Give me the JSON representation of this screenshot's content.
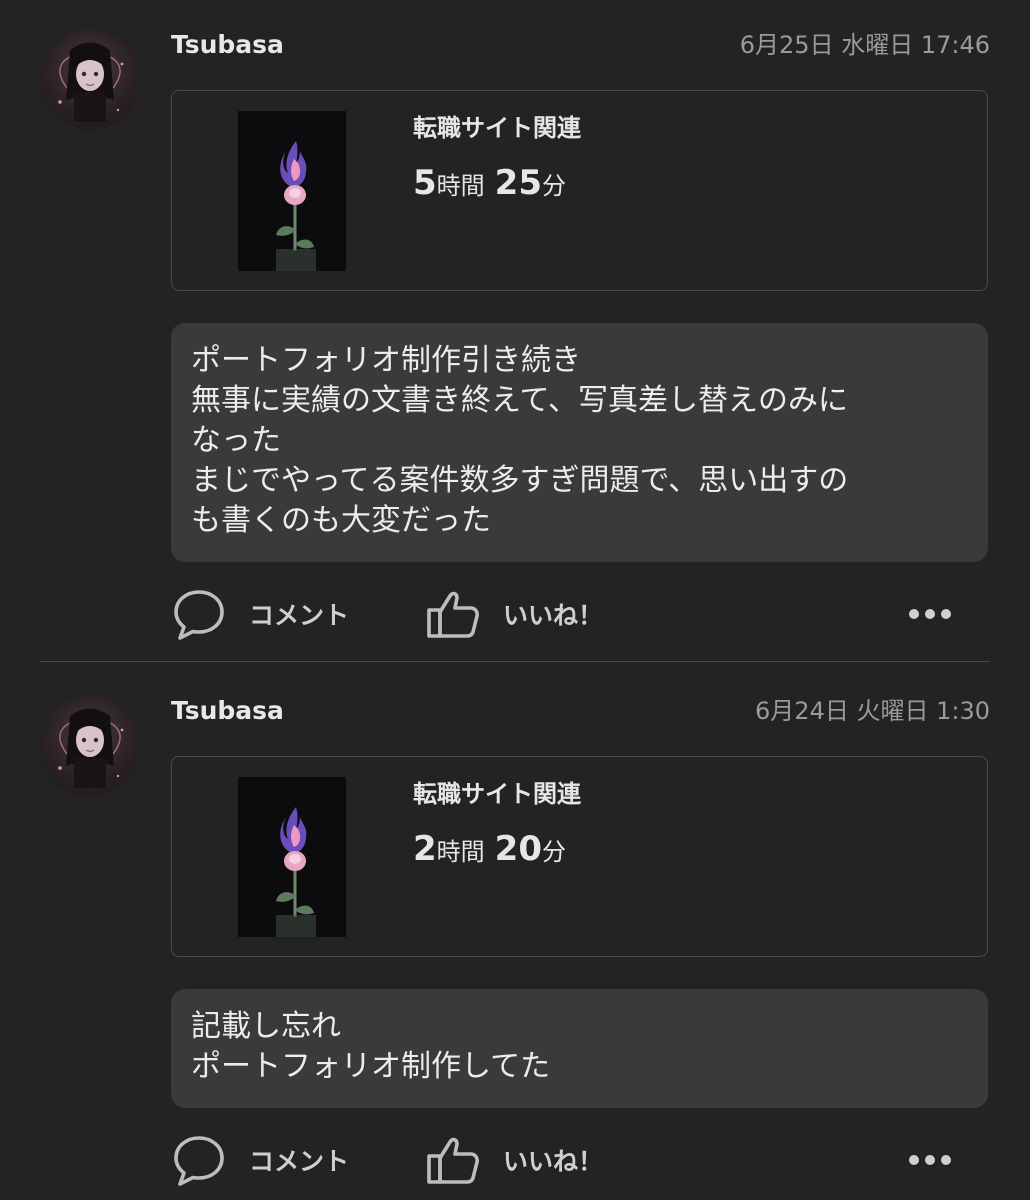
{
  "posts": [
    {
      "username": "Tsubasa",
      "timestamp": "6月25日 水曜日 17:46",
      "record": {
        "title": "転職サイト関連",
        "hours": "5",
        "hours_unit": "時間",
        "minutes": "25",
        "minutes_unit": "分"
      },
      "note": "ポートフォリオ制作引き続き\n無事に実績の文書き終えて、写真差し替えのみに\nなった\nまじでやってる案件数多すぎ問題で、思い出すの\nも書くのも大変だった",
      "actions": {
        "comment": "コメント",
        "like": "いいね！"
      }
    },
    {
      "username": "Tsubasa",
      "timestamp": "6月24日 火曜日 1:30",
      "record": {
        "title": "転職サイト関連",
        "hours": "2",
        "hours_unit": "時間",
        "minutes": "20",
        "minutes_unit": "分"
      },
      "note": "記載し忘れ\nポートフォリオ制作してた",
      "actions": {
        "comment": "コメント",
        "like": "いいね！"
      }
    }
  ],
  "icons": {
    "avatar": "avatar-image",
    "thumbnail": "rose-flame-image",
    "comment": "speech-bubble-icon",
    "like": "thumbs-up-icon",
    "more": "more-dots-icon"
  },
  "colors": {
    "background": "#232323",
    "note_background": "#3a3a3a",
    "card_border": "#4a4a4a",
    "timestamp": "#9a9a9a"
  }
}
